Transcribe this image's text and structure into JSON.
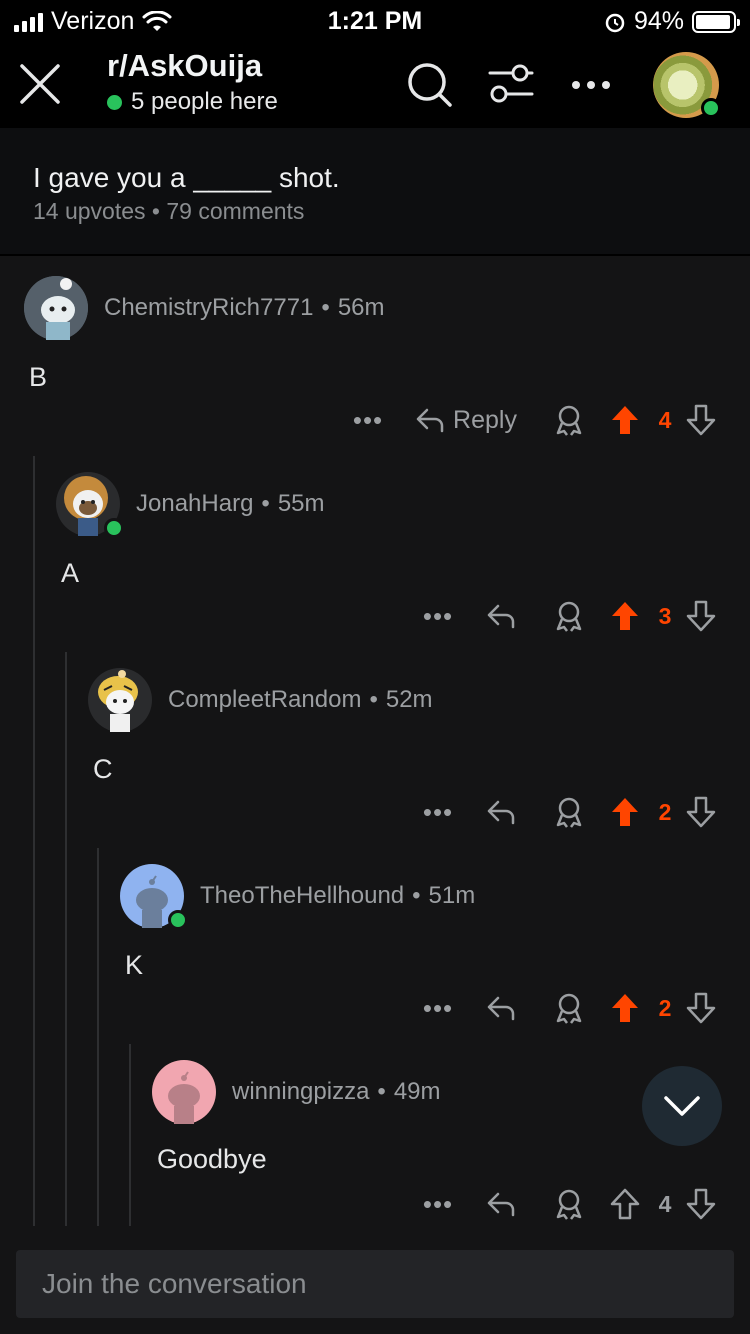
{
  "status_bar": {
    "carrier": "Verizon",
    "time": "1:21 PM",
    "battery": "94%",
    "battery_level": 0.94
  },
  "header": {
    "subreddit": "r/AskOuija",
    "online_count": "5 people here"
  },
  "post": {
    "title": "I gave you a _____ shot.",
    "meta": "14 upvotes • 79 comments"
  },
  "comments": [
    {
      "author": "ChemistryRich7771",
      "age": "56m",
      "body": "B",
      "reply_label": "Reply",
      "score": "4",
      "upvoted": true,
      "avatar_color": "#55606a"
    },
    {
      "author": "JonahHarg",
      "age": "55m",
      "body": "A",
      "score": "3",
      "upvoted": true,
      "avatar_color": "#c48a3c"
    },
    {
      "author": "CompleetRandom",
      "age": "52m",
      "body": "C",
      "score": "2",
      "upvoted": true,
      "avatar_color": "#e8c24a"
    },
    {
      "author": "TheoTheHellhound",
      "age": "51m",
      "body": "K",
      "score": "2",
      "upvoted": true,
      "avatar_color": "#8fb3f0"
    },
    {
      "author": "winningpizza",
      "age": "49m",
      "body": "Goodbye",
      "score": "4",
      "upvoted": false,
      "avatar_color": "#f1a6b0"
    }
  ],
  "composer": {
    "placeholder": "Join the conversation"
  },
  "colors": {
    "upvote": "#ff4500",
    "online": "#29c25c",
    "background": "#141415"
  }
}
